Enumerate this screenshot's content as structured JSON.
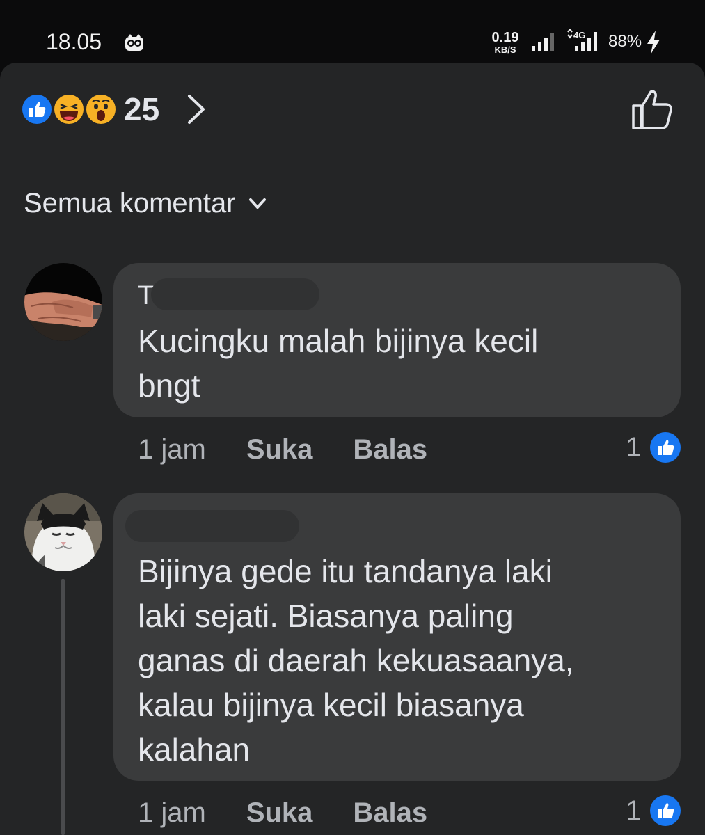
{
  "status_bar": {
    "time": "18.05",
    "net_speed_value": "0.19",
    "net_speed_unit": "KB/S",
    "network_type": "4G",
    "battery": "88%",
    "icons": [
      "owl-notification-icon",
      "wifi-signal-icon",
      "cellular-signal-icon",
      "charging-bolt-icon"
    ]
  },
  "reactions": {
    "types": [
      "like",
      "haha",
      "wow"
    ],
    "count": "25"
  },
  "filter": {
    "label": "Semua komentar"
  },
  "comments": [
    {
      "author_initial": "T",
      "text_lines": [
        "Kucingku malah bijinya kecil",
        "bngt"
      ],
      "time": "1 jam",
      "like_label": "Suka",
      "reply_label": "Balas",
      "likes": "1"
    },
    {
      "author_initial": "",
      "text_lines": [
        "Bijinya gede itu tandanya laki",
        "laki sejati. Biasanya paling",
        "ganas di daerah kekuasaanya,",
        "kalau bijinya kecil biasanya",
        "kalahan"
      ],
      "time": "1 jam",
      "like_label": "Suka",
      "reply_label": "Balas",
      "likes": "1"
    }
  ],
  "colors": {
    "background": "#242526",
    "bubble": "#3a3b3c",
    "facebook_blue": "#1877f2",
    "secondary_text": "#b0b3b8"
  }
}
